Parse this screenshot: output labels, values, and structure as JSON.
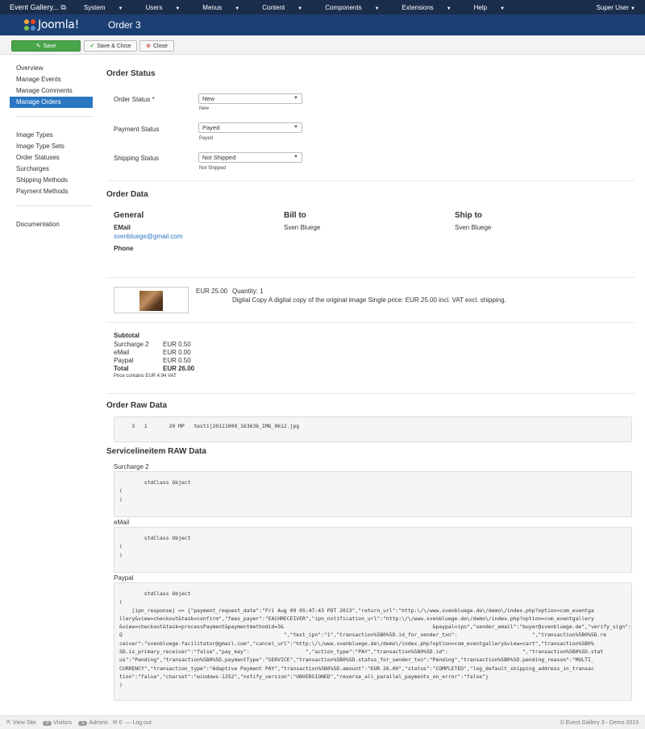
{
  "topnav": {
    "site": "Event Gallery...",
    "menu": [
      "System",
      "Users",
      "Menus",
      "Content",
      "Components",
      "Extensions",
      "Help"
    ],
    "user": "Super User"
  },
  "header": {
    "logo": "Joomla!",
    "title": "Order 3"
  },
  "toolbar": {
    "save": "Save",
    "save_close": "Save & Close",
    "close": "Close"
  },
  "sidebar": {
    "group1": [
      "Overview",
      "Manage Events",
      "Manage Comments",
      "Manage Orders"
    ],
    "group2": [
      "Image Types",
      "Image Type Sets",
      "Order Statuses",
      "Surcharges",
      "Shipping Methods",
      "Payment Methods"
    ],
    "group3": [
      "Documentation"
    ],
    "active": "Manage Orders"
  },
  "order_status": {
    "heading": "Order Status",
    "fields": [
      {
        "label": "Order Status *",
        "value": "New",
        "help": "New"
      },
      {
        "label": "Payment Status",
        "value": "Payed",
        "help": "Payed"
      },
      {
        "label": "Shipping Status",
        "value": "Not Shipped",
        "help": "Not Shipped"
      }
    ]
  },
  "order_data": {
    "heading": "Order Data",
    "general": {
      "title": "General",
      "email_label": "EMail",
      "email": "svenbluege@gmail.com",
      "phone_label": "Phone"
    },
    "bill_to": {
      "title": "Bill to",
      "name": "Sven Bluege"
    },
    "ship_to": {
      "title": "Ship to",
      "name": "Sven Bluege"
    },
    "item": {
      "price": "EUR 25.00",
      "quantity": "Quantity: 1",
      "description": "Digital Copy A digital copy of the original image Single price: EUR 25.00 incl. VAT excl. shipping."
    },
    "totals": {
      "subtotal_label": "Subtotal",
      "rows": [
        {
          "label": "Surcharge 2",
          "value": "EUR 0.50"
        },
        {
          "label": "eMail",
          "value": "EUR 0.00"
        },
        {
          "label": "Paypal",
          "value": "EUR 0.50"
        },
        {
          "label": "Total",
          "value": "EUR 26.00"
        }
      ],
      "vat_note": "Price contains EUR 4.94 VAT"
    }
  },
  "raw": {
    "heading": "Order Raw Data",
    "text": "    3   1       20 MP   test1|20111009_163636_IMG_0612.jpg"
  },
  "service": {
    "heading": "Servicelineitem RAW Data",
    "blocks": [
      {
        "label": "Surcharge 2",
        "text": "        stdClass Object\n(\n)"
      },
      {
        "label": "eMail",
        "text": "        stdClass Object\n(\n)"
      },
      {
        "label": "Paypal",
        "text": "        stdClass Object\n(\n    [ipn_response] => {\"payment_request_date\":\"Fri Aug 09 05:47:43 PDT 2013\",\"return_url\":\"http:\\/\\/www.svenbluege.de\\/demo\\/index.php?option=com_eventga\nllery&view=checkout&task=confirm\",\"fees_payer\":\"EACHRECEIVER\",\"ipn_notification_url\":\"http:\\/\\/www.svenbluege.de\\/demo\\/index.php?option=com_eventgallery\n&view=checkout&task=processPayment&paymentmethodid=3&                                                &paypal=ipn\",\"sender_email\":\"buyer@svenbluege.de\",\"verify_sign\":\"A\nQ                                                    \",\"test_ipn\":\"1\",\"transaction%5B0%5D.id_for_sender_txn\":                        \",\"transaction%5B0%5D.re\nceiver\":\"svenbluege-facilitator@gmail.com\",\"cancel_url\":\"http:\\/\\/www.svenbluege.de\\/demo\\/index.php?option=com_eventgallery&view=cart\",\"transaction%5B0%\n5D.is_primary_receiver\":\"false\",\"pay_key\":                  \",\"action_type\":\"PAY\",\"transaction%5B0%5D.id\":                        \",\"transaction%5B0%5D.stat\nus\":\"Pending\",\"transaction%5B0%5D.paymentType\":\"SERVICE\",\"transaction%5B0%5D.status_for_sender_txn\":\"Pending\",\"transaction%5B0%5D.pending_reason\":\"MULTI_\nCURRENCY\",\"transaction_type\":\"Adaptive Payment PAY\",\"transaction%5B0%5D.amount\":\"EUR 26.00\",\"status\":\"COMPLETED\",\"log_default_shipping_address_in_transac\ntion\":\"false\",\"charset\":\"windows-1252\",\"notify_version\":\"UNVERSIONED\",\"reverse_all_parallel_payments_on_error\":\"false\"}\n)"
      }
    ]
  },
  "footer": {
    "view_site": "View Site",
    "visitors_count": "0",
    "visitors": "Visitors",
    "admins_count": "1",
    "admins": "Admins",
    "messages": "0",
    "logout": "Log out",
    "copyright": "© Event Gallery 3 - Demo 2013"
  },
  "colors": {
    "topnav": "#1a2e4c",
    "header": "#1c3f74",
    "save": "#4aa44a",
    "active": "#2c77c1"
  }
}
